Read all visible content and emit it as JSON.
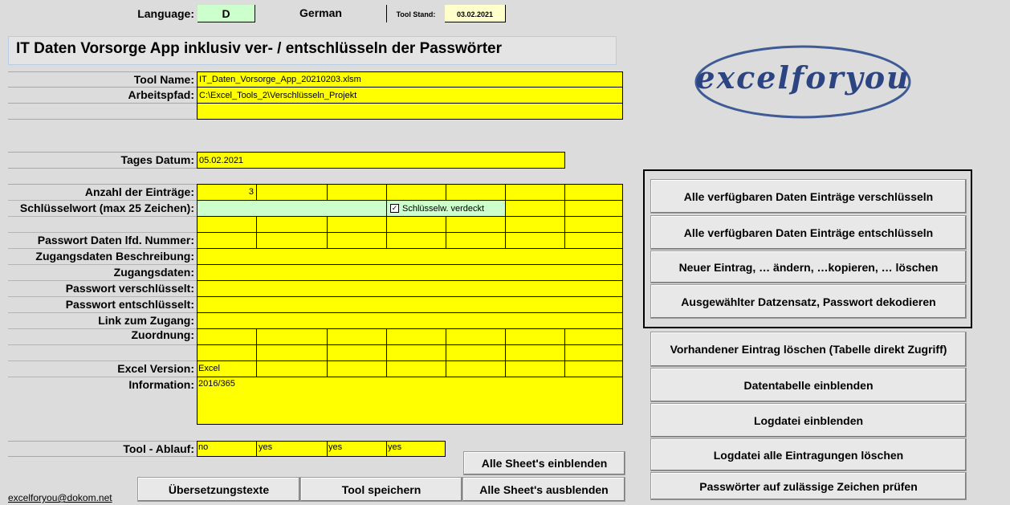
{
  "header": {
    "language_label": "Language:",
    "language_code": "D",
    "language_name": "German",
    "stand_label": "Tool Stand:",
    "stand_date": "03.02.2021"
  },
  "title": "IT Daten Vorsorge App inklusiv ver- / entschlüsseln der Passwörter",
  "logo": {
    "text": "excelforyou"
  },
  "fields": {
    "tool_name_label": "Tool Name:",
    "tool_name_value": "IT_Daten_Vorsorge_App_20210203.xlsm",
    "path_label": "Arbeitspfad:",
    "path_value": "C:\\Excel_Tools_2\\Verschlüsseln_Projekt",
    "date_label": "Tages Datum:",
    "date_value": "05.02.2021",
    "count_label": "Anzahl der Einträge:",
    "count_value": "3",
    "key_label": "Schlüsselwort (max 25 Zeichen):",
    "key_value": "",
    "checkbox_label": "Schlüsselw. verdeckt",
    "checkbox_checked": true,
    "pw_nr_label": "Passwort Daten lfd. Nummer:",
    "access_desc_label": "Zugangsdaten Beschreibung:",
    "access_data_label": "Zugangsdaten:",
    "pw_enc_label": "Passwort verschlüsselt:",
    "pw_dec_label": "Passwort entschlüsselt:",
    "link_label": "Link zum Zugang:",
    "assign_label": "Zuordnung:",
    "excel_version_label": "Excel Version:",
    "excel_version_value": "Excel 2016/365",
    "info_label": "Information:",
    "flow_label": "Tool - Ablauf:",
    "flow_values": [
      "no",
      "yes",
      "yes",
      "yes"
    ]
  },
  "buttons_bottom": {
    "show_sheets": "Alle Sheet's einblenden",
    "translations": "Übersetzungstexte",
    "save_tool": "Tool speichern",
    "hide_sheets": "Alle Sheet's ausblenden"
  },
  "email": "excelforyou@dokom.net",
  "buttons_right": {
    "encrypt_all": "Alle verfügbaren Daten Einträge verschlüsseln",
    "decrypt_all": "Alle verfügbaren Daten Einträge entschlüsseln",
    "new_entry": "Neuer Eintrag, … ändern, …kopieren, … löschen",
    "decode_selected": "Ausgewählter Datzensatz, Passwort dekodieren",
    "delete_existing": "Vorhandener Eintrag löschen (Tabelle direkt Zugriff)",
    "show_data_table": "Datentabelle einblenden",
    "show_log": "Logdatei einblenden",
    "clear_log": "Logdatei alle Eintragungen löschen",
    "check_passwords": "Passwörter auf zulässige Zeichen prüfen"
  }
}
